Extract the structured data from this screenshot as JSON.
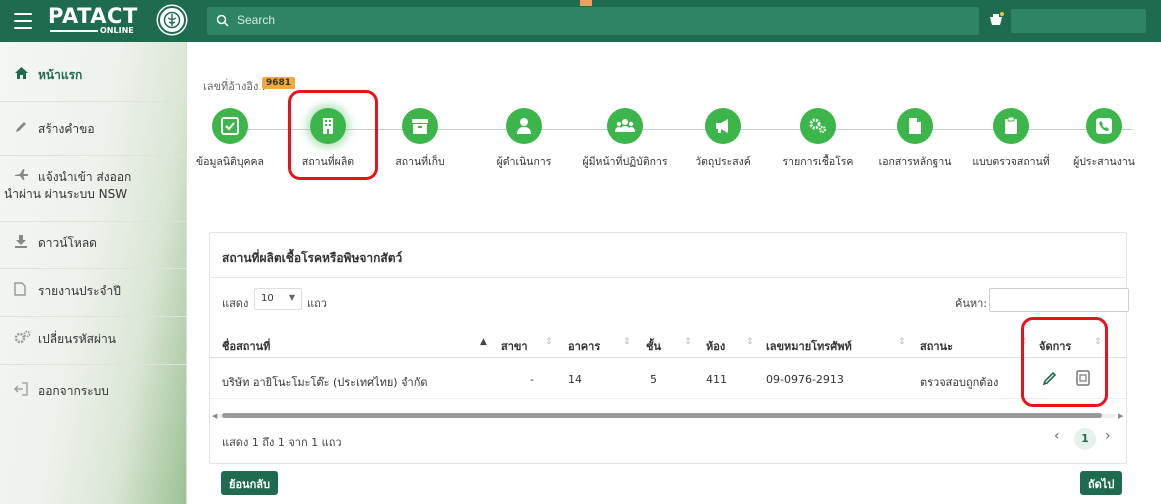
{
  "header": {
    "logo_text": "PATACT",
    "logo_sub": "ONLINE",
    "search_placeholder": "Search"
  },
  "sidebar": {
    "items": [
      {
        "label": "หน้าแรก",
        "icon": "home-icon"
      },
      {
        "label": "สร้างคำขอ",
        "icon": "pencil-icon"
      },
      {
        "label": "แจ้งนำเข้า ส่งออก",
        "label2": "นำผ่าน ผ่านระบบ NSW",
        "icon": "plane-icon"
      },
      {
        "label": "ดาวน์โหลด",
        "icon": "download-icon"
      },
      {
        "label": "รายงานประจำปี",
        "icon": "file-icon"
      },
      {
        "label": "เปลี่ยนรหัสผ่าน",
        "icon": "gears-icon"
      },
      {
        "label": "ออกจากระบบ",
        "icon": "logout-icon"
      }
    ]
  },
  "ref": {
    "label": "เลขที่อ้างอิง :",
    "value": "9681"
  },
  "steps": [
    {
      "label": "ข้อมูลนิติบุคคล",
      "icon": "check-square-icon"
    },
    {
      "label": "สถานที่ผลิต",
      "icon": "building-icon"
    },
    {
      "label": "สถานที่เก็บ",
      "icon": "archive-icon"
    },
    {
      "label": "ผู้ดำเนินการ",
      "icon": "user-icon"
    },
    {
      "label": "ผู้มีหน้าที่ปฏิบัติการ",
      "icon": "users-icon"
    },
    {
      "label": "วัตถุประสงค์",
      "icon": "megaphone-icon"
    },
    {
      "label": "รายการเชื้อโรค",
      "icon": "cogs-icon"
    },
    {
      "label": "เอกสารหลักฐาน",
      "icon": "file-icon"
    },
    {
      "label": "แบบตรวจสถานที่",
      "icon": "clipboard-icon"
    },
    {
      "label": "ผู้ประสานงาน",
      "icon": "phone-icon"
    }
  ],
  "table": {
    "title": "สถานที่ผลิตเชื้อโรคหรือพิษจากสัตว์",
    "length_prefix": "แสดง",
    "length_value": "10",
    "length_suffix": "แถว",
    "search_label": "ค้นหา:",
    "columns": [
      "ชื่อสถานที่",
      "สาขา",
      "อาคาร",
      "ชั้น",
      "ห้อง",
      "เลขหมายโทรศัพท์",
      "สถานะ",
      "จัดการ"
    ],
    "rows": [
      {
        "name": "บริษัท อายิโนะโมะโต๊ะ (ประเทศไทย) จำกัด",
        "branch": "-",
        "building": "14",
        "floor": "5",
        "room": "411",
        "phone": "09-0976-2913",
        "status": "ตรวจสอบถูกต้อง"
      }
    ],
    "info": "แสดง 1 ถึง 1 จาก 1 แถว",
    "page": "1"
  },
  "buttons": {
    "back": "ย้อนกลับ",
    "next": "ถัดไป"
  },
  "colors": {
    "header": "#1f6b4f",
    "step": "#3cb54a",
    "highlight": "#e8121b",
    "badge": "#f0a93b"
  }
}
